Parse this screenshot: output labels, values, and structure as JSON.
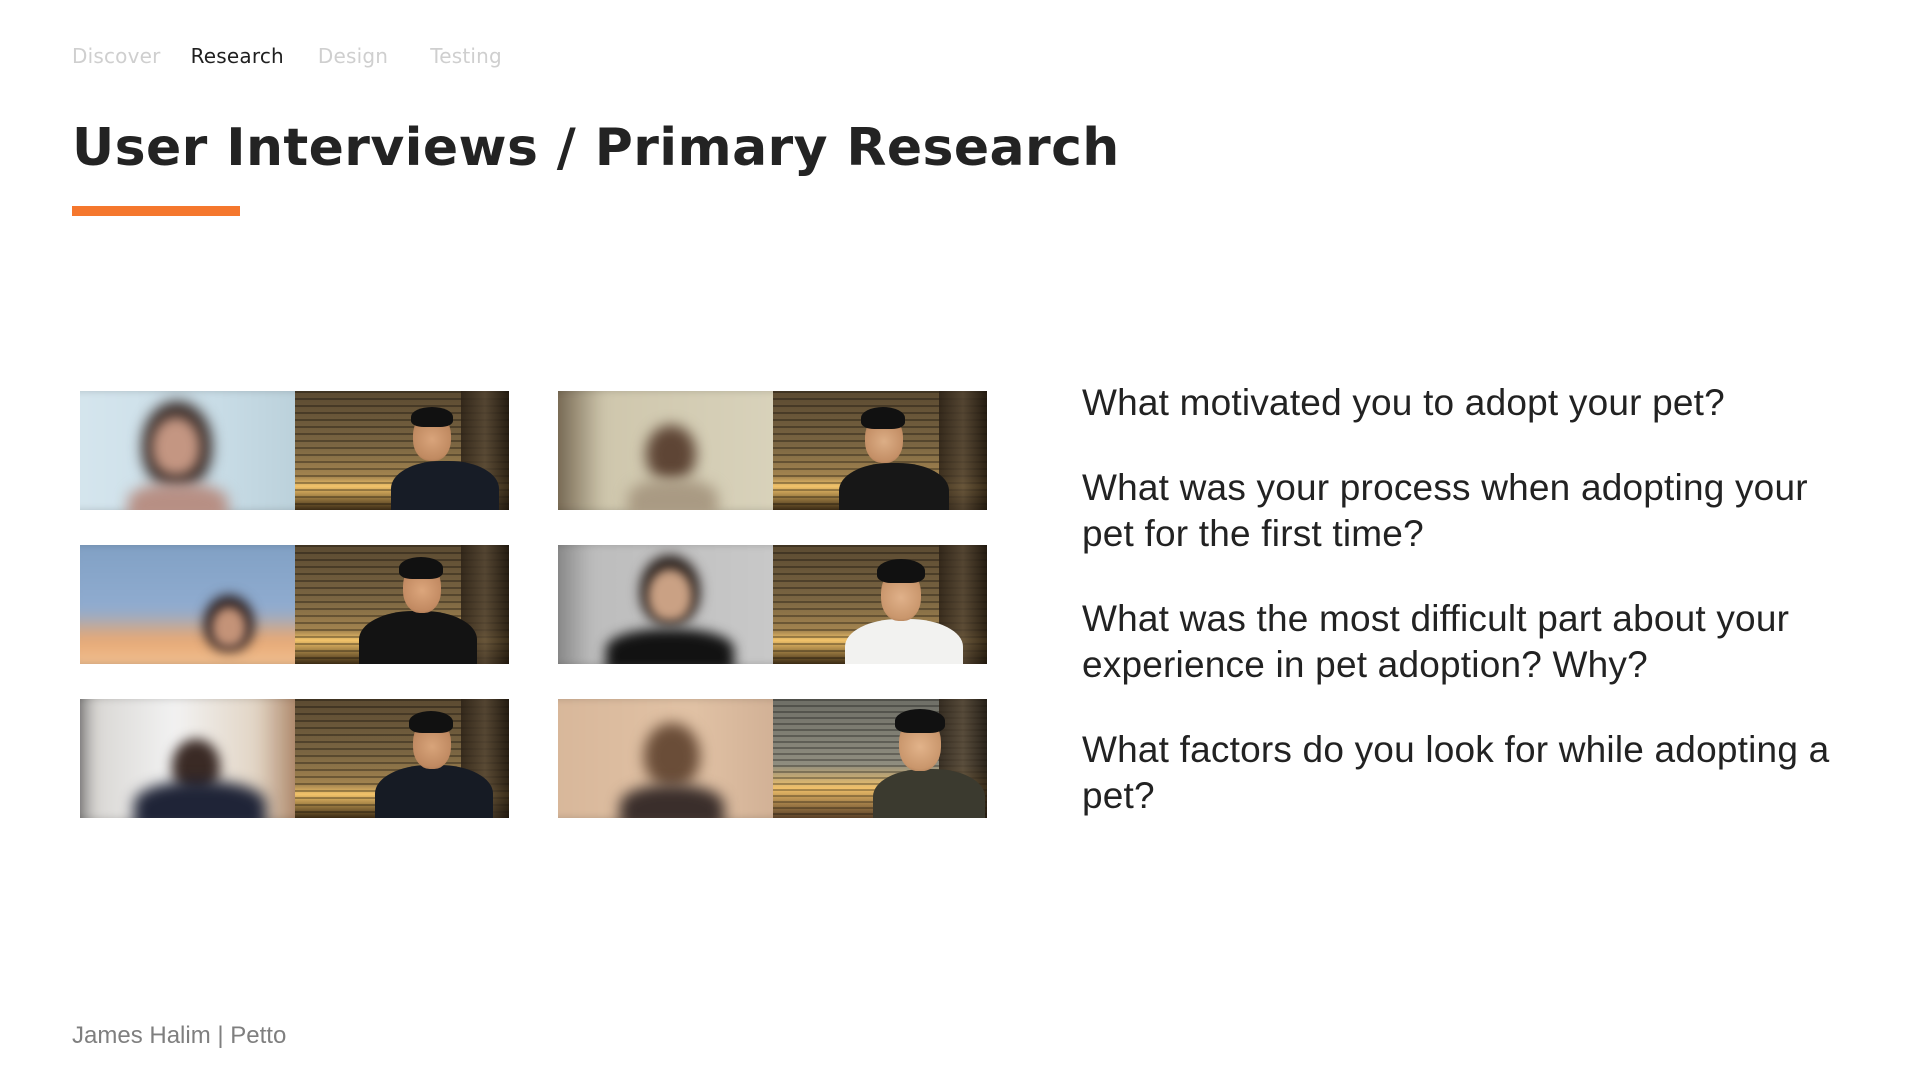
{
  "nav": {
    "items": [
      {
        "label": "Discover",
        "active": false
      },
      {
        "label": "Research",
        "active": true
      },
      {
        "label": "Design",
        "active": false
      },
      {
        "label": "Testing",
        "active": false
      }
    ]
  },
  "title": "User Interviews / Primary Research",
  "colors": {
    "accent": "#f5772d",
    "title": "#232323",
    "nav_inactive": "#cfcfcf",
    "footer": "#7f7f7f"
  },
  "interviews": [
    {
      "participant": "blurred",
      "interviewer": "visible"
    },
    {
      "participant": "blurred",
      "interviewer": "visible"
    },
    {
      "participant": "blurred",
      "interviewer": "visible"
    },
    {
      "participant": "blurred",
      "interviewer": "visible"
    },
    {
      "participant": "blurred",
      "interviewer": "visible"
    },
    {
      "participant": "blurred",
      "interviewer": "visible"
    }
  ],
  "questions": [
    "What motivated you to adopt your pet?",
    "What was your process when adopting your pet for the first time?",
    "What was the most difficult part about your experience in pet adoption? Why?",
    "What factors do you look for while adopting a pet?"
  ],
  "footer": "James Halim | Petto"
}
